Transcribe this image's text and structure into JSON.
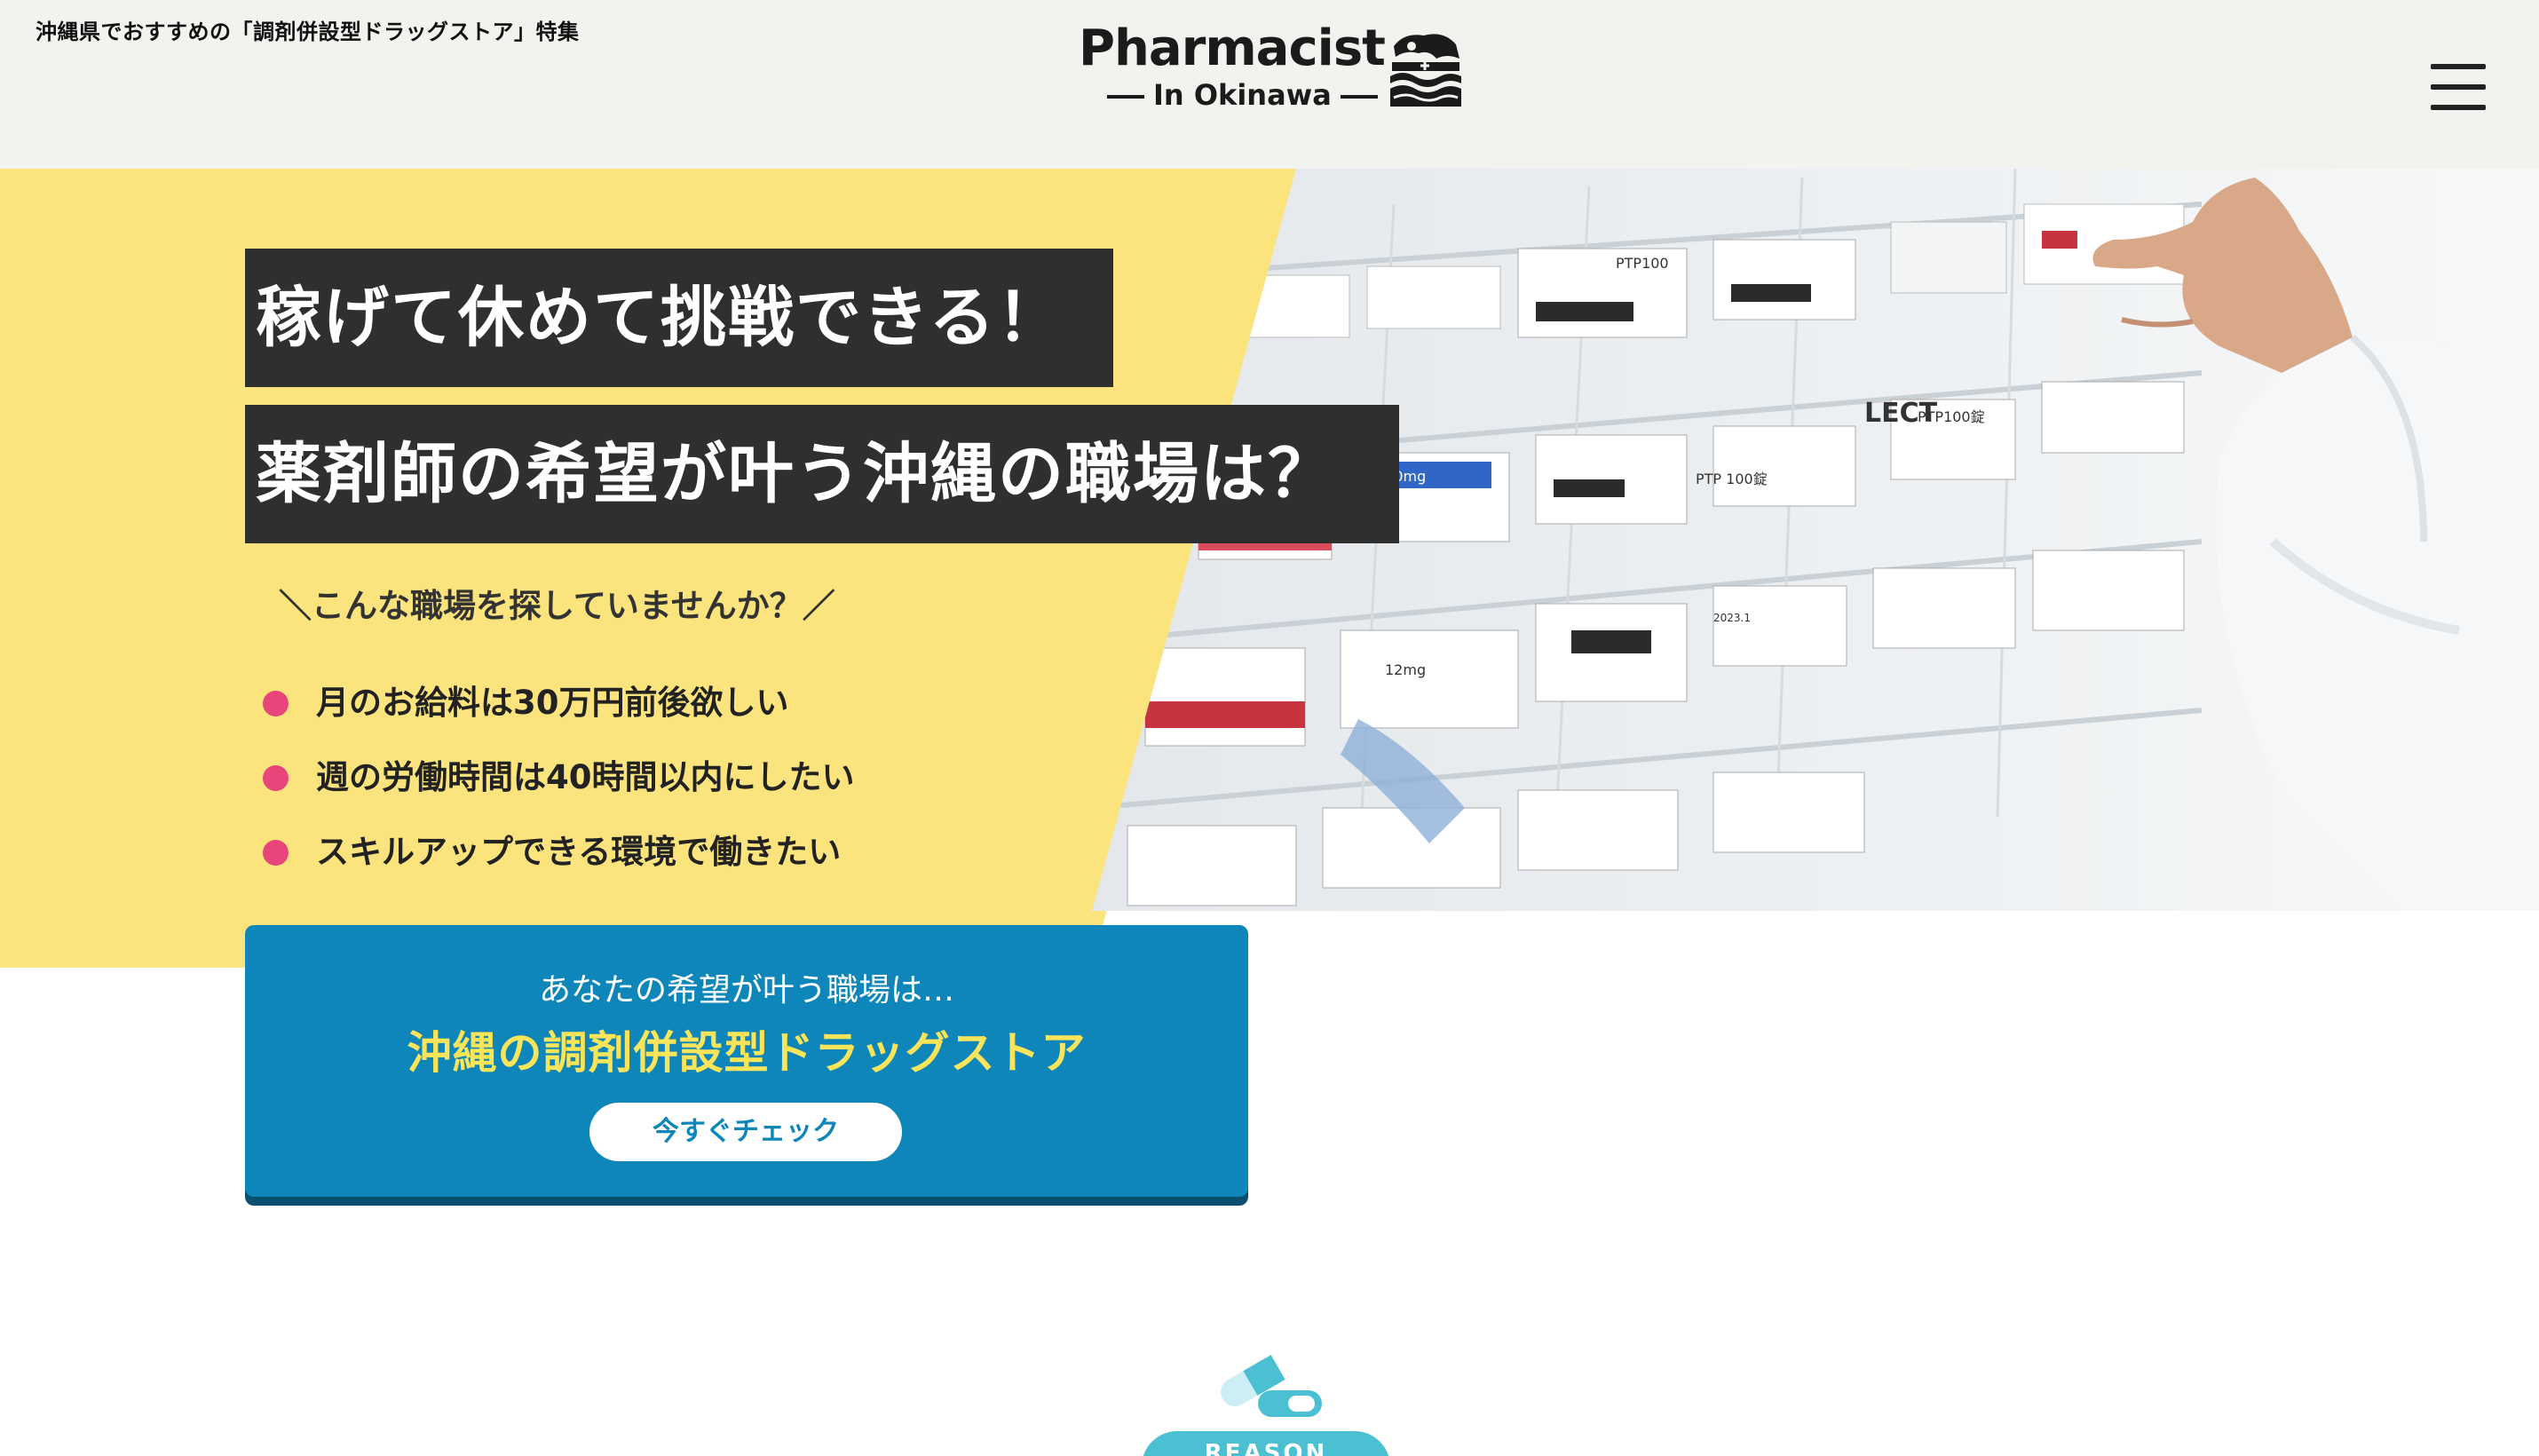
{
  "header": {
    "tagline": "沖縄県でおすすめの「調剤併設型ドラッグストア」特集",
    "logo_title": "Pharmacist",
    "logo_sub": "In Okinawa",
    "menu_icon": "hamburger-menu-icon"
  },
  "hero": {
    "headline_1": "稼げて休めて挑戦できる！",
    "headline_2": "薬剤師の希望が叶う沖縄の職場は？",
    "question": "＼こんな職場を探していませんか？／",
    "wishes": [
      "月のお給料は30万円前後欲しい",
      "週の労働時間は40時間以内にしたい",
      "スキルアップできる環境で働きたい"
    ],
    "photo_text": {
      "ptp1": "PTP100",
      "ptp2": "PTP 100錠",
      "ptp3": "PTP100錠",
      "box_100mg": "100mg",
      "box_lect": "LECT",
      "box_date": "2023.1",
      "box_12mg": "12mg"
    }
  },
  "cta": {
    "lead": "あなたの希望が叶う職場は…",
    "main": "沖縄の調剤併設型ドラッグストア",
    "button": "今すぐチェック"
  },
  "reason": {
    "badge": "REASON"
  },
  "colors": {
    "header_bg": "#f2f2ef",
    "hero_yellow": "#fbe47d",
    "headline_bg": "#2f2f2f",
    "bullet_pink": "#e8457a",
    "cta_blue": "#0e86b9",
    "cta_accent": "#f9e45a",
    "reason_teal": "#4cc0d3"
  }
}
